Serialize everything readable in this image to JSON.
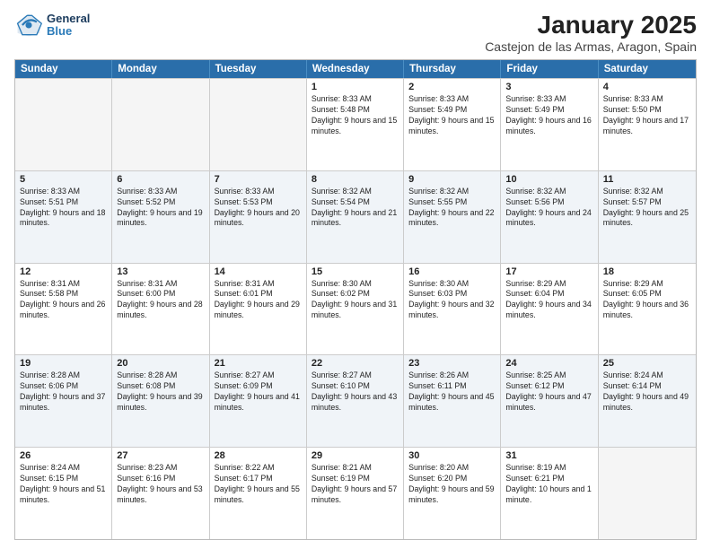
{
  "header": {
    "logo_line1": "General",
    "logo_line2": "Blue",
    "month": "January 2025",
    "location": "Castejon de las Armas, Aragon, Spain"
  },
  "weekdays": [
    "Sunday",
    "Monday",
    "Tuesday",
    "Wednesday",
    "Thursday",
    "Friday",
    "Saturday"
  ],
  "weeks": [
    [
      {
        "day": "",
        "sunrise": "",
        "sunset": "",
        "daylight": "",
        "empty": true
      },
      {
        "day": "",
        "sunrise": "",
        "sunset": "",
        "daylight": "",
        "empty": true
      },
      {
        "day": "",
        "sunrise": "",
        "sunset": "",
        "daylight": "",
        "empty": true
      },
      {
        "day": "1",
        "sunrise": "Sunrise: 8:33 AM",
        "sunset": "Sunset: 5:48 PM",
        "daylight": "Daylight: 9 hours and 15 minutes.",
        "empty": false
      },
      {
        "day": "2",
        "sunrise": "Sunrise: 8:33 AM",
        "sunset": "Sunset: 5:49 PM",
        "daylight": "Daylight: 9 hours and 15 minutes.",
        "empty": false
      },
      {
        "day": "3",
        "sunrise": "Sunrise: 8:33 AM",
        "sunset": "Sunset: 5:49 PM",
        "daylight": "Daylight: 9 hours and 16 minutes.",
        "empty": false
      },
      {
        "day": "4",
        "sunrise": "Sunrise: 8:33 AM",
        "sunset": "Sunset: 5:50 PM",
        "daylight": "Daylight: 9 hours and 17 minutes.",
        "empty": false
      }
    ],
    [
      {
        "day": "5",
        "sunrise": "Sunrise: 8:33 AM",
        "sunset": "Sunset: 5:51 PM",
        "daylight": "Daylight: 9 hours and 18 minutes.",
        "empty": false
      },
      {
        "day": "6",
        "sunrise": "Sunrise: 8:33 AM",
        "sunset": "Sunset: 5:52 PM",
        "daylight": "Daylight: 9 hours and 19 minutes.",
        "empty": false
      },
      {
        "day": "7",
        "sunrise": "Sunrise: 8:33 AM",
        "sunset": "Sunset: 5:53 PM",
        "daylight": "Daylight: 9 hours and 20 minutes.",
        "empty": false
      },
      {
        "day": "8",
        "sunrise": "Sunrise: 8:32 AM",
        "sunset": "Sunset: 5:54 PM",
        "daylight": "Daylight: 9 hours and 21 minutes.",
        "empty": false
      },
      {
        "day": "9",
        "sunrise": "Sunrise: 8:32 AM",
        "sunset": "Sunset: 5:55 PM",
        "daylight": "Daylight: 9 hours and 22 minutes.",
        "empty": false
      },
      {
        "day": "10",
        "sunrise": "Sunrise: 8:32 AM",
        "sunset": "Sunset: 5:56 PM",
        "daylight": "Daylight: 9 hours and 24 minutes.",
        "empty": false
      },
      {
        "day": "11",
        "sunrise": "Sunrise: 8:32 AM",
        "sunset": "Sunset: 5:57 PM",
        "daylight": "Daylight: 9 hours and 25 minutes.",
        "empty": false
      }
    ],
    [
      {
        "day": "12",
        "sunrise": "Sunrise: 8:31 AM",
        "sunset": "Sunset: 5:58 PM",
        "daylight": "Daylight: 9 hours and 26 minutes.",
        "empty": false
      },
      {
        "day": "13",
        "sunrise": "Sunrise: 8:31 AM",
        "sunset": "Sunset: 6:00 PM",
        "daylight": "Daylight: 9 hours and 28 minutes.",
        "empty": false
      },
      {
        "day": "14",
        "sunrise": "Sunrise: 8:31 AM",
        "sunset": "Sunset: 6:01 PM",
        "daylight": "Daylight: 9 hours and 29 minutes.",
        "empty": false
      },
      {
        "day": "15",
        "sunrise": "Sunrise: 8:30 AM",
        "sunset": "Sunset: 6:02 PM",
        "daylight": "Daylight: 9 hours and 31 minutes.",
        "empty": false
      },
      {
        "day": "16",
        "sunrise": "Sunrise: 8:30 AM",
        "sunset": "Sunset: 6:03 PM",
        "daylight": "Daylight: 9 hours and 32 minutes.",
        "empty": false
      },
      {
        "day": "17",
        "sunrise": "Sunrise: 8:29 AM",
        "sunset": "Sunset: 6:04 PM",
        "daylight": "Daylight: 9 hours and 34 minutes.",
        "empty": false
      },
      {
        "day": "18",
        "sunrise": "Sunrise: 8:29 AM",
        "sunset": "Sunset: 6:05 PM",
        "daylight": "Daylight: 9 hours and 36 minutes.",
        "empty": false
      }
    ],
    [
      {
        "day": "19",
        "sunrise": "Sunrise: 8:28 AM",
        "sunset": "Sunset: 6:06 PM",
        "daylight": "Daylight: 9 hours and 37 minutes.",
        "empty": false
      },
      {
        "day": "20",
        "sunrise": "Sunrise: 8:28 AM",
        "sunset": "Sunset: 6:08 PM",
        "daylight": "Daylight: 9 hours and 39 minutes.",
        "empty": false
      },
      {
        "day": "21",
        "sunrise": "Sunrise: 8:27 AM",
        "sunset": "Sunset: 6:09 PM",
        "daylight": "Daylight: 9 hours and 41 minutes.",
        "empty": false
      },
      {
        "day": "22",
        "sunrise": "Sunrise: 8:27 AM",
        "sunset": "Sunset: 6:10 PM",
        "daylight": "Daylight: 9 hours and 43 minutes.",
        "empty": false
      },
      {
        "day": "23",
        "sunrise": "Sunrise: 8:26 AM",
        "sunset": "Sunset: 6:11 PM",
        "daylight": "Daylight: 9 hours and 45 minutes.",
        "empty": false
      },
      {
        "day": "24",
        "sunrise": "Sunrise: 8:25 AM",
        "sunset": "Sunset: 6:12 PM",
        "daylight": "Daylight: 9 hours and 47 minutes.",
        "empty": false
      },
      {
        "day": "25",
        "sunrise": "Sunrise: 8:24 AM",
        "sunset": "Sunset: 6:14 PM",
        "daylight": "Daylight: 9 hours and 49 minutes.",
        "empty": false
      }
    ],
    [
      {
        "day": "26",
        "sunrise": "Sunrise: 8:24 AM",
        "sunset": "Sunset: 6:15 PM",
        "daylight": "Daylight: 9 hours and 51 minutes.",
        "empty": false
      },
      {
        "day": "27",
        "sunrise": "Sunrise: 8:23 AM",
        "sunset": "Sunset: 6:16 PM",
        "daylight": "Daylight: 9 hours and 53 minutes.",
        "empty": false
      },
      {
        "day": "28",
        "sunrise": "Sunrise: 8:22 AM",
        "sunset": "Sunset: 6:17 PM",
        "daylight": "Daylight: 9 hours and 55 minutes.",
        "empty": false
      },
      {
        "day": "29",
        "sunrise": "Sunrise: 8:21 AM",
        "sunset": "Sunset: 6:19 PM",
        "daylight": "Daylight: 9 hours and 57 minutes.",
        "empty": false
      },
      {
        "day": "30",
        "sunrise": "Sunrise: 8:20 AM",
        "sunset": "Sunset: 6:20 PM",
        "daylight": "Daylight: 9 hours and 59 minutes.",
        "empty": false
      },
      {
        "day": "31",
        "sunrise": "Sunrise: 8:19 AM",
        "sunset": "Sunset: 6:21 PM",
        "daylight": "Daylight: 10 hours and 1 minute.",
        "empty": false
      },
      {
        "day": "",
        "sunrise": "",
        "sunset": "",
        "daylight": "",
        "empty": true
      }
    ]
  ]
}
